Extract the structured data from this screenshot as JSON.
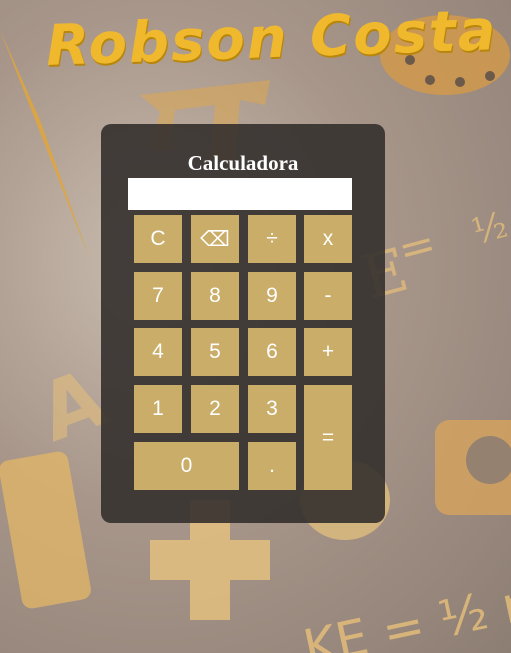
{
  "brand": {
    "title": "Robson Costa"
  },
  "calculator": {
    "title": "Calculadora",
    "display_value": "",
    "keys": {
      "clear": "C",
      "backspace": "⌫",
      "divide": "÷",
      "multiply": "x",
      "seven": "7",
      "eight": "8",
      "nine": "9",
      "minus": "-",
      "four": "4",
      "five": "5",
      "six": "6",
      "plus": "+",
      "one": "1",
      "two": "2",
      "three": "3",
      "equals": "=",
      "zero": "0",
      "decimal": "."
    }
  },
  "colors": {
    "brand": "#f0b92d",
    "panel": "#34302e",
    "key": "#c9ad68",
    "key_text": "#ffffff"
  }
}
